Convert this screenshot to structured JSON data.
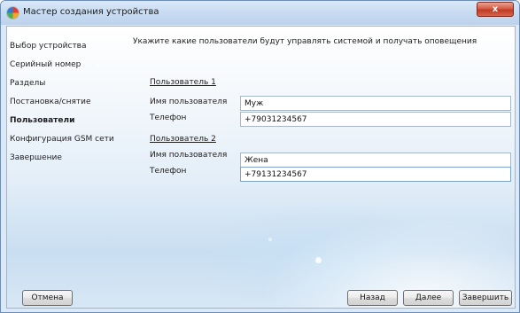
{
  "window": {
    "title": "Мастер создания устройства",
    "close_label": "x"
  },
  "sidebar": {
    "items": [
      {
        "label": "Выбор устройства",
        "active": false
      },
      {
        "label": "Серийный номер",
        "active": false
      },
      {
        "label": "Разделы",
        "active": false
      },
      {
        "label": "Постановка/снятие",
        "active": false
      },
      {
        "label": "Пользователи",
        "active": true
      },
      {
        "label": "Конфигурация GSM сети",
        "active": false
      },
      {
        "label": "Завершение",
        "active": false
      }
    ]
  },
  "main": {
    "instruction": "Укажите какие пользователи будут управлять системой и получать оповещения",
    "users": [
      {
        "heading": "Пользователь 1",
        "name_label": "Имя пользователя",
        "name_value": "Муж",
        "phone_label": "Телефон",
        "phone_value": "+79031234567"
      },
      {
        "heading": "Пользователь 2",
        "name_label": "Имя пользователя",
        "name_value": "Жена",
        "phone_label": "Телефон",
        "phone_value": "+79131234567"
      }
    ]
  },
  "footer": {
    "cancel_label": "Отмена",
    "back_label": "Назад",
    "next_label": "Далее",
    "finish_label": "Завершить"
  },
  "icons": {
    "app": "app-logo-icon",
    "close": "close-icon"
  },
  "colors": {
    "titlebar": "#c9dcf2",
    "close_button": "#c13a24",
    "background_bottom": "#c9def1"
  }
}
